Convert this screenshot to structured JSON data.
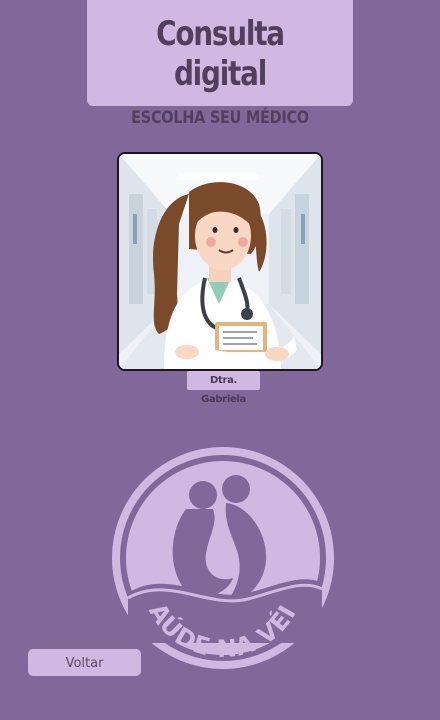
{
  "header": {
    "title": "Consulta digital",
    "subtitle": "ESCOLHA SEU MÉDICO"
  },
  "doctors": [
    {
      "name": "Dtra. Gabriela"
    }
  ],
  "logo": {
    "text": "SAÚDE NA VÉIA"
  },
  "footer": {
    "back_label": "Voltar"
  },
  "colors": {
    "background": "#82679a",
    "panel": "#d1b8e2",
    "text_dark": "#523f5c"
  }
}
